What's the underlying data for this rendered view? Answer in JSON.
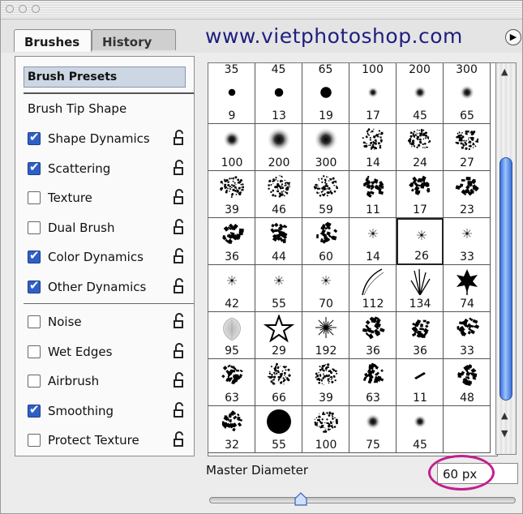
{
  "tabs": [
    {
      "label": "Brushes",
      "active": true
    },
    {
      "label": "History",
      "active": false
    }
  ],
  "watermark": "www.vietphotoshop.com",
  "left_panel": {
    "presets_button": "Brush Presets",
    "tip_shape": "Brush Tip Shape",
    "group1": [
      {
        "label": "Shape Dynamics",
        "checked": true
      },
      {
        "label": "Scattering",
        "checked": true
      },
      {
        "label": "Texture",
        "checked": false
      },
      {
        "label": "Dual Brush",
        "checked": false
      },
      {
        "label": "Color Dynamics",
        "checked": true
      },
      {
        "label": "Other Dynamics",
        "checked": true
      }
    ],
    "group2": [
      {
        "label": "Noise",
        "checked": false
      },
      {
        "label": "Wet Edges",
        "checked": false
      },
      {
        "label": "Airbrush",
        "checked": false
      },
      {
        "label": "Smoothing",
        "checked": true
      },
      {
        "label": "Protect Texture",
        "checked": false
      }
    ]
  },
  "brush_grid": {
    "header_sizes": [
      "35",
      "45",
      "65",
      "100",
      "200",
      "300"
    ],
    "rows": [
      [
        {
          "size": "9",
          "kind": "hard"
        },
        {
          "size": "13",
          "kind": "hard"
        },
        {
          "size": "19",
          "kind": "hard"
        },
        {
          "size": "17",
          "kind": "soft"
        },
        {
          "size": "45",
          "kind": "soft"
        },
        {
          "size": "65",
          "kind": "soft"
        }
      ],
      [
        {
          "size": "100",
          "kind": "soft"
        },
        {
          "size": "200",
          "kind": "soft"
        },
        {
          "size": "300",
          "kind": "soft"
        },
        {
          "size": "14",
          "kind": "spatter"
        },
        {
          "size": "24",
          "kind": "spatter"
        },
        {
          "size": "27",
          "kind": "spatter"
        }
      ],
      [
        {
          "size": "39",
          "kind": "spatter"
        },
        {
          "size": "46",
          "kind": "spatter"
        },
        {
          "size": "59",
          "kind": "spatter"
        },
        {
          "size": "11",
          "kind": "chalk"
        },
        {
          "size": "17",
          "kind": "chalk"
        },
        {
          "size": "23",
          "kind": "chalk"
        }
      ],
      [
        {
          "size": "36",
          "kind": "chalk"
        },
        {
          "size": "44",
          "kind": "chalk"
        },
        {
          "size": "60",
          "kind": "chalk"
        },
        {
          "size": "14",
          "kind": "star"
        },
        {
          "size": "26",
          "kind": "star"
        },
        {
          "size": "33",
          "kind": "star"
        }
      ],
      [
        {
          "size": "42",
          "kind": "star"
        },
        {
          "size": "55",
          "kind": "star"
        },
        {
          "size": "70",
          "kind": "star"
        },
        {
          "size": "112",
          "kind": "stroke"
        },
        {
          "size": "134",
          "kind": "grass"
        },
        {
          "size": "74",
          "kind": "leaf"
        }
      ],
      [
        {
          "size": "95",
          "kind": "fuzzy-leaf"
        },
        {
          "size": "29",
          "kind": "outline-star"
        },
        {
          "size": "192",
          "kind": "starburst"
        },
        {
          "size": "36",
          "kind": "chalk"
        },
        {
          "size": "36",
          "kind": "chalk"
        },
        {
          "size": "33",
          "kind": "chalk"
        }
      ],
      [
        {
          "size": "63",
          "kind": "chalk"
        },
        {
          "size": "66",
          "kind": "spatter"
        },
        {
          "size": "39",
          "kind": "spatter"
        },
        {
          "size": "63",
          "kind": "chalk"
        },
        {
          "size": "11",
          "kind": "chalk-small"
        },
        {
          "size": "48",
          "kind": "chalk"
        }
      ],
      [
        {
          "size": "32",
          "kind": "chalk"
        },
        {
          "size": "55",
          "kind": "hard"
        },
        {
          "size": "100",
          "kind": "spatter"
        },
        {
          "size": "75",
          "kind": "soft"
        },
        {
          "size": "45",
          "kind": "soft"
        },
        {
          "size": "",
          "kind": "empty"
        }
      ]
    ],
    "selected_index": 22
  },
  "bottom": {
    "master_label": "Master Diameter",
    "diameter_value": "60 px",
    "slider_fraction": 0.3
  },
  "colors": {
    "highlight_ring": "#c2208f",
    "checkbox_on": "#2f5fc6",
    "scroll_thumb": "#3a6fd6"
  }
}
